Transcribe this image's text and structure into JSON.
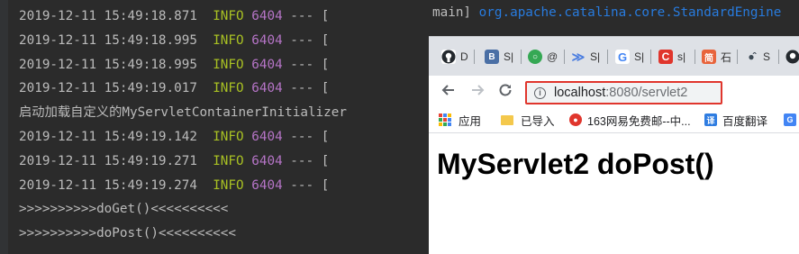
{
  "console": {
    "lines": [
      {
        "ts": "2019-12-11 15:49:18.871",
        "level": "INFO",
        "pid": "6404",
        "sep": "--- ["
      },
      {
        "ts": "2019-12-11 15:49:18.995",
        "level": "INFO",
        "pid": "6404",
        "sep": "--- ["
      },
      {
        "ts": "2019-12-11 15:49:18.995",
        "level": "INFO",
        "pid": "6404",
        "sep": "--- ["
      },
      {
        "ts": "2019-12-11 15:49:19.017",
        "level": "INFO",
        "pid": "6404",
        "sep": "--- ["
      }
    ],
    "message": "启动加载自定义的MyServletContainerInitializer",
    "lines2": [
      {
        "ts": "2019-12-11 15:49:19.142",
        "level": "INFO",
        "pid": "6404",
        "sep": "--- ["
      },
      {
        "ts": "2019-12-11 15:49:19.271",
        "level": "INFO",
        "pid": "6404",
        "sep": "--- ["
      },
      {
        "ts": "2019-12-11 15:49:19.274",
        "level": "INFO",
        "pid": "6404",
        "sep": "--- ["
      }
    ],
    "doget": ">>>>>>>>>>doGet()<<<<<<<<<<",
    "dopost": ">>>>>>>>>>doPost()<<<<<<<<<<",
    "right_prefix": "main]",
    "right_class": "org.apache.catalina.core.StandardEngine"
  },
  "browser": {
    "tabs": [
      {
        "icon": "github-icon",
        "label": "D",
        "color": "#24292e"
      },
      {
        "icon": "bookmark-b-icon",
        "label": "S|",
        "color": "#4a6fa5"
      },
      {
        "icon": "green-circle-icon",
        "label": "@",
        "color": "#35a854"
      },
      {
        "icon": "chevrons-icon",
        "label": "S|",
        "color": "#4a7de0"
      },
      {
        "icon": "google-icon",
        "label": "S|",
        "color": "#4285f4"
      },
      {
        "icon": "csdn-icon",
        "label": "s|",
        "color": "#e0362d"
      },
      {
        "icon": "jian-icon",
        "label": "石",
        "color": "#e8643c"
      },
      {
        "icon": "dots-icon",
        "label": "S",
        "color": "#3d4a55"
      },
      {
        "icon": "github2-icon",
        "label": "",
        "color": "#24292e"
      }
    ],
    "url_host": "localhost",
    "url_path": ":8080/servlet2",
    "bookmarks": {
      "apps": "应用",
      "imported": "已导入",
      "mail163": "163网易免费邮--中...",
      "translate": "百度翻译"
    },
    "page_heading": "MyServlet2 doPost()"
  }
}
